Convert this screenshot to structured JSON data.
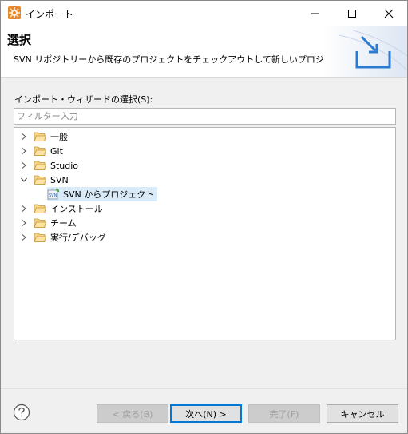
{
  "window": {
    "title": "インポート"
  },
  "header": {
    "title": "選択",
    "description": "SVN リポジトリーから既存のプロジェクトをチェックアウトして新しいプロジェクトを作成します。"
  },
  "wizard_select": {
    "label": "インポート・ウィザードの選択(S):",
    "filter_placeholder": "フィルター入力"
  },
  "tree": {
    "items": [
      {
        "label": "一般",
        "expanded": false
      },
      {
        "label": "Git",
        "expanded": false
      },
      {
        "label": "Studio",
        "expanded": false
      },
      {
        "label": "SVN",
        "expanded": true,
        "children": [
          {
            "label": "SVN からプロジェクト",
            "selected": true
          }
        ]
      },
      {
        "label": "インストール",
        "expanded": false
      },
      {
        "label": "チーム",
        "expanded": false
      },
      {
        "label": "実行/デバッグ",
        "expanded": false
      }
    ]
  },
  "buttons": {
    "back": "< 戻る(B)",
    "next": "次へ(N) >",
    "finish": "完了(F)",
    "cancel": "キャンセル"
  },
  "colors": {
    "accent": "#0078d7",
    "selection": "#d9ebf9",
    "folder": "#e8b44a"
  }
}
